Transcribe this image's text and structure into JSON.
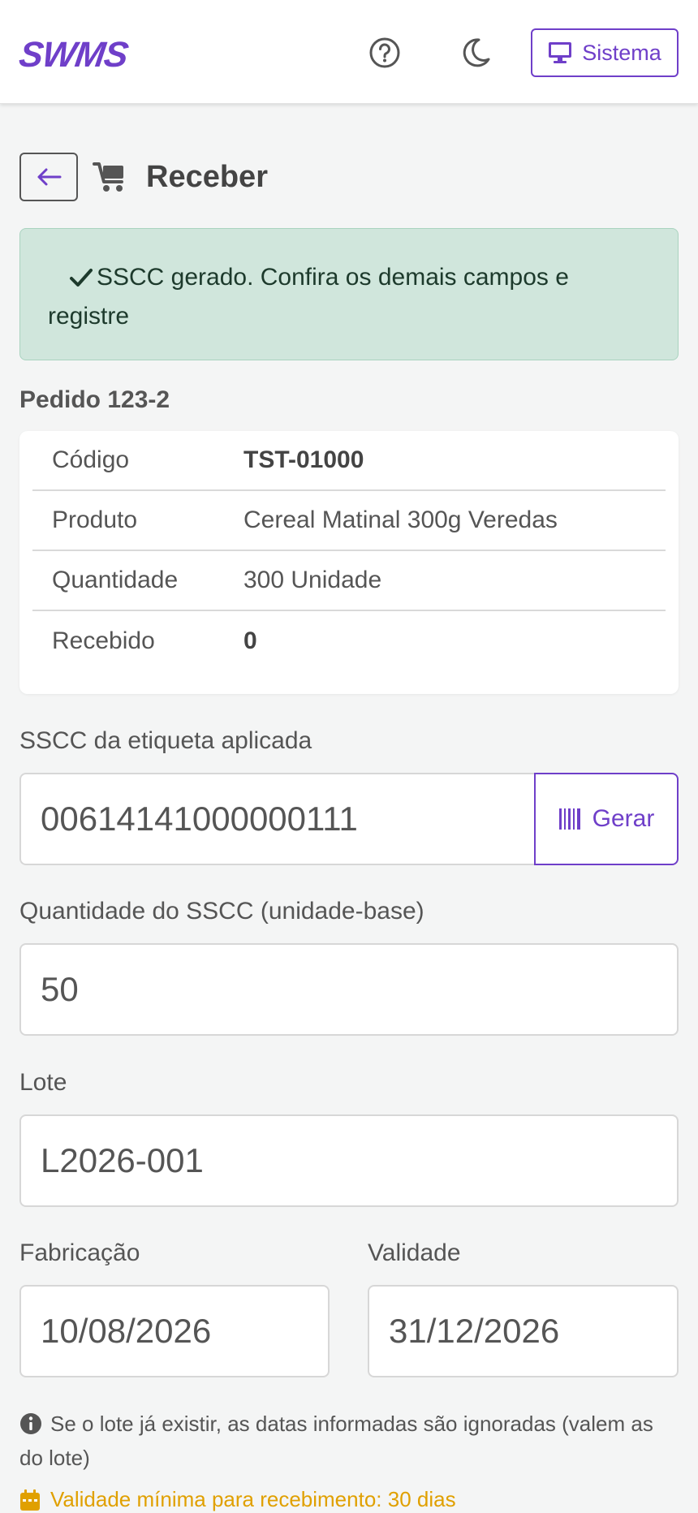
{
  "app": {
    "logo_text": "SWMS",
    "brand_color": "#6f3fc9"
  },
  "topbar": {
    "help_icon": "question-circle-icon",
    "theme_icon": "moon-icon",
    "system_button_label": "Sistema",
    "system_icon": "monitor-icon"
  },
  "page": {
    "title": "Receber",
    "back_icon": "arrow-left-icon",
    "title_icon": "cart-icon"
  },
  "alert": {
    "text": "SSCC gerado. Confira os demais campos e registre",
    "icon": "check-icon",
    "bg_color": "#d0e6dc"
  },
  "order": {
    "heading": "Pedido 123-2",
    "rows": [
      {
        "label": "Código",
        "value": "TST-01000"
      },
      {
        "label": "Produto",
        "value": "Cereal Matinal 300g Veredas"
      },
      {
        "label": "Quantidade",
        "value": "300 Unidade"
      },
      {
        "label": "Recebido",
        "value": "0"
      }
    ]
  },
  "form": {
    "sscc_label": "SSCC da etiqueta aplicada",
    "sscc_value": "00614141000000111",
    "generate_label": "Gerar",
    "generate_icon": "barcode-icon",
    "qty_label": "Quantidade do SSCC (unidade-base)",
    "qty_value": "50",
    "lot_label": "Lote",
    "lot_value": "L2026-001",
    "mfg_label": "Fabricação",
    "mfg_value": "10/08/2026",
    "exp_label": "Validade",
    "exp_value": "31/12/2026"
  },
  "notes": {
    "info_text": "Se o lote já existir, as datas informadas são ignoradas (valem as do lote)",
    "info_icon": "info-circle-icon",
    "warning_text": "Validade mínima para recebimento: 30 dias",
    "warning_icon": "calendar-icon",
    "warning_color": "#e0a000"
  }
}
